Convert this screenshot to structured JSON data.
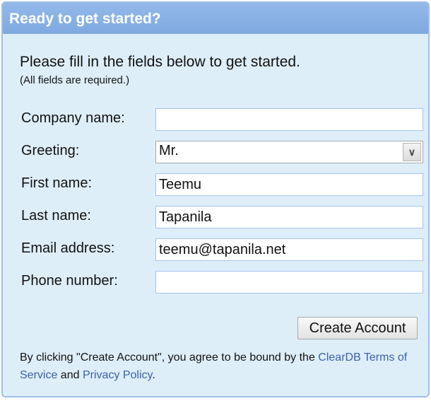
{
  "header": {
    "title": "Ready to get started?"
  },
  "intro": "Please fill in the fields below to get started.",
  "required_note": "(All fields are required.)",
  "fields": [
    {
      "label": "Company name:",
      "value": ""
    },
    {
      "label": "Greeting:",
      "value": "Mr."
    },
    {
      "label": "First name:",
      "value": "Teemu"
    },
    {
      "label": "Last name:",
      "value": "Tapanila"
    },
    {
      "label": "Email address:",
      "value": "teemu@tapanila.net"
    },
    {
      "label": "Phone number:",
      "value": ""
    }
  ],
  "submit_label": "Create Account",
  "footer": {
    "text1": "By clicking \"Create Account\", you agree to be bound by the ",
    "link1": "ClearDB Terms of Service",
    "text2": " and ",
    "link2": "Privacy Policy",
    "text3": "."
  },
  "colors": {
    "header": "#8db4e6",
    "body": "#deeef9",
    "link": "#3b5fa8"
  }
}
